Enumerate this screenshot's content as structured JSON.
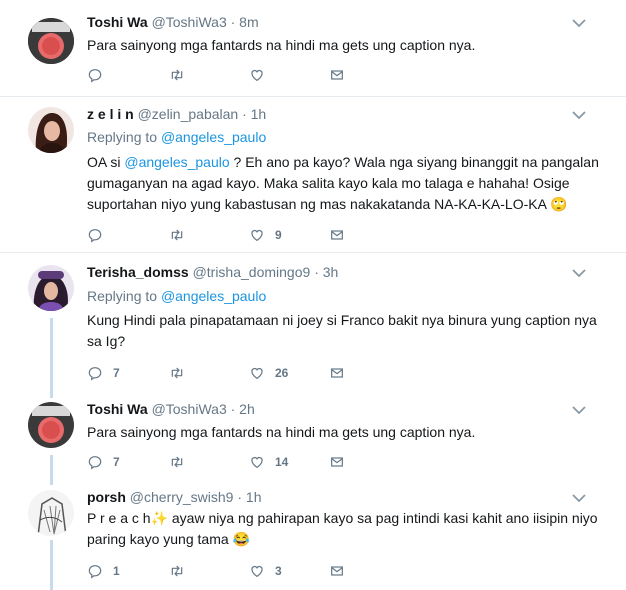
{
  "tweets": [
    {
      "name": "Toshi Wa",
      "handle": "@ToshiWa3",
      "time": "· 8m",
      "replying_prefix": "",
      "replying_handle": "",
      "text": "Para sainyong mga fantards na hindi ma gets ung caption nya.",
      "replies": "",
      "likes": "",
      "avatar": "toshi"
    },
    {
      "name": "z e l i n",
      "handle": "@zelin_pabalan",
      "time": "· 1h",
      "replying_prefix": "Replying to",
      "replying_handle": "@angeles_paulo",
      "text_before": "OA si ",
      "text_mention": "@angeles_paulo",
      "text_after": " ? Eh ano pa kayo? Wala nga siyang binanggit na pangalan gumaganyan na agad kayo. Maka salita kayo kala mo talaga e hahaha! Osige suportahan niyo yung kabastusan ng mas nakakatanda NA-KA-KA-LO-KA 🙄",
      "replies": "",
      "likes": "9",
      "avatar": "zelin"
    },
    {
      "name": "Terisha_domss",
      "handle": "@trisha_domingo9",
      "time": "· 3h",
      "replying_prefix": "Replying to",
      "replying_handle": "@angeles_paulo",
      "text": "Kung Hindi pala pinapatamaan ni joey si Franco bakit nya binura yung caption nya sa Ig?",
      "replies": "7",
      "likes": "26",
      "avatar": "terisha"
    },
    {
      "name": "Toshi Wa",
      "handle": "@ToshiWa3",
      "time": "· 2h",
      "text": "Para sainyong mga fantards na hindi ma gets ung caption nya.",
      "replies": "7",
      "likes": "14",
      "avatar": "toshi"
    },
    {
      "name": "porsh",
      "handle": "@cherry_swish9",
      "time": "· 1h",
      "text_preach": "P r e a c h",
      "text_sparkle": "✨",
      "text_after": " ayaw niya ng pahirapan kayo sa pag intindi kasi kahit ano iisipin niyo paring kayo yung tama 😂",
      "replies": "1",
      "likes": "3",
      "avatar": "porsh"
    }
  ],
  "icons": [
    "reply-icon",
    "retweet-icon",
    "like-icon",
    "dm-icon",
    "chevron-down-icon"
  ],
  "colors": {
    "link": "#1b95e0",
    "meta": "#657786",
    "thread_line": "#c6dcee",
    "separator": "#e6ecf0"
  }
}
